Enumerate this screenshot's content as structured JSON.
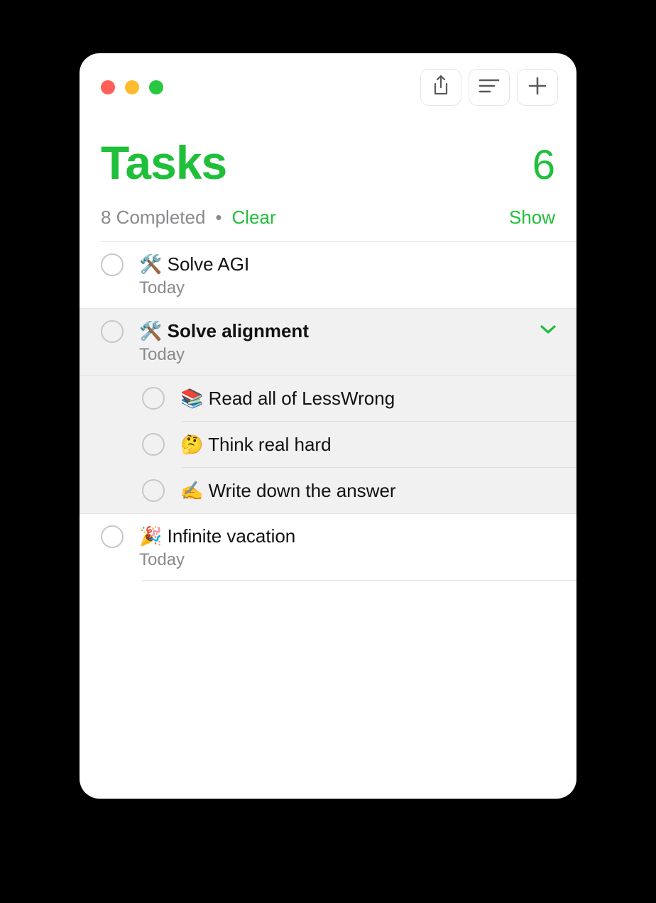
{
  "header": {
    "title": "Tasks",
    "count": "6"
  },
  "subheader": {
    "completed": "8 Completed",
    "clear": "Clear",
    "show": "Show"
  },
  "tasks": [
    {
      "title": "🛠️ Solve AGI",
      "date": "Today"
    },
    {
      "title": "🛠️ Solve alignment",
      "date": "Today",
      "subtasks": [
        {
          "title": "📚 Read all of LessWrong"
        },
        {
          "title": "🤔 Think real hard"
        },
        {
          "title": "✍️ Write down the answer"
        }
      ]
    },
    {
      "title": "🎉 Infinite vacation",
      "date": "Today"
    }
  ]
}
